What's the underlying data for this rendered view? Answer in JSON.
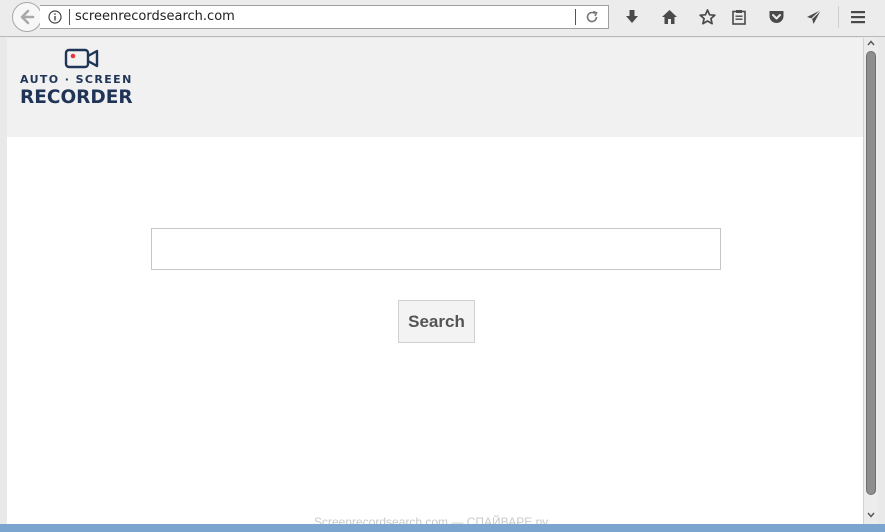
{
  "browser": {
    "url": "screenrecordsearch.com",
    "icons": {
      "back": "back-arrow-icon",
      "info": "info-icon",
      "reload": "reload-icon",
      "downloads": "download-icon",
      "home": "home-icon",
      "bookmark": "star-icon",
      "reading_list": "clipboard-icon",
      "pocket": "pocket-icon",
      "send": "send-icon",
      "menu": "hamburger-menu-icon"
    }
  },
  "page": {
    "logo": {
      "top_line": "AUTO · SCREEN",
      "bottom_line": "RECORDER",
      "color": "#1f3457",
      "accent": "#e8343f"
    },
    "search": {
      "value": "",
      "placeholder": "",
      "button_label": "Search"
    },
    "watermark": "Screenrecordsearch.com — СПАЙВАРЕ.ру"
  }
}
